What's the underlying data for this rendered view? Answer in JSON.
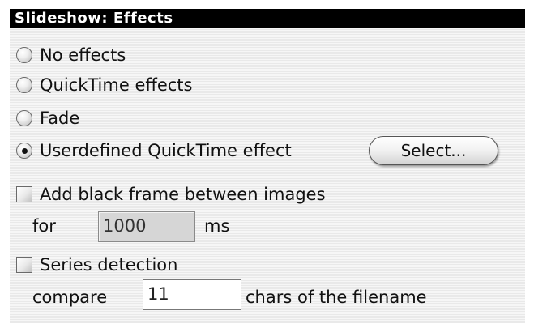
{
  "window": {
    "title": "Slideshow: Effects"
  },
  "options": {
    "no_effects": {
      "label": "No effects",
      "checked": false
    },
    "quicktime_effects": {
      "label": "QuickTime effects",
      "checked": false
    },
    "fade": {
      "label": "Fade",
      "checked": false
    },
    "userdefined": {
      "label": "Userdefined QuickTime effect",
      "checked": true
    }
  },
  "select_button": {
    "label": "Select..."
  },
  "black_frame": {
    "label": "Add black frame between images",
    "checked": false,
    "for_label": "for",
    "value": "1000",
    "unit": "ms",
    "field_enabled": false
  },
  "series": {
    "label": "Series detection",
    "checked": false,
    "compare_label": "compare",
    "value": "11",
    "suffix": "chars of the filename"
  }
}
